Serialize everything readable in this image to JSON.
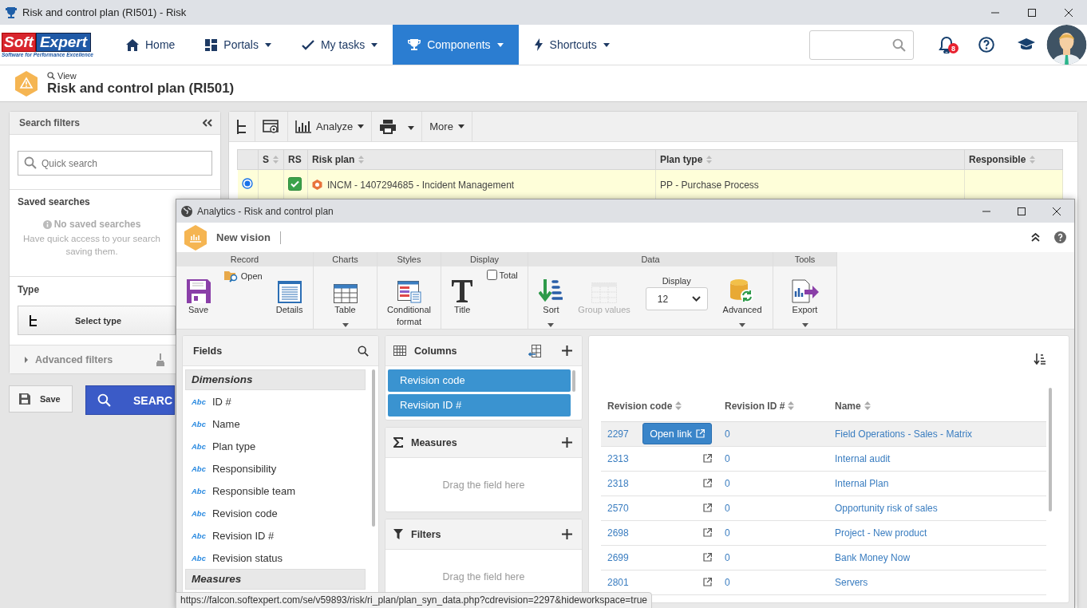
{
  "window": {
    "title": "Risk and control plan (RI501) - Risk"
  },
  "logo": {
    "word_1": "Soft",
    "word_2": "Expert",
    "tagline": "Software for Performance Excellence"
  },
  "nav": [
    {
      "label": "Home",
      "dropdown": false,
      "selected": false
    },
    {
      "label": "Portals",
      "dropdown": true,
      "selected": false
    },
    {
      "label": "My tasks",
      "dropdown": true,
      "selected": false
    },
    {
      "label": "Components",
      "dropdown": true,
      "selected": true
    },
    {
      "label": "Shortcuts",
      "dropdown": true,
      "selected": false
    }
  ],
  "notifications": {
    "count": "8"
  },
  "page": {
    "mode": "View",
    "title": "Risk and control plan (RI501)"
  },
  "filters": {
    "title": "Search filters",
    "quick_search_placeholder": "Quick search",
    "saved_title": "Saved searches",
    "empty_title": "No saved searches",
    "empty_text_1": "Have quick access to your search",
    "empty_text_2": "saving them.",
    "type_label": "Type",
    "type_button": "Select type",
    "advanced": {
      "label": "Advanced filters",
      "expanded": false
    },
    "save": "Save",
    "search": "SEARC"
  },
  "toolbar": {
    "analyze": "Analyze",
    "more": "More"
  },
  "main_table": {
    "columns": [
      "S",
      "RS",
      "Risk plan",
      "Plan type",
      "Responsible"
    ],
    "rows": [
      {
        "selected": true,
        "rs_checked": true,
        "risk_plan": "INCM - 1407294685 - Incident Management",
        "plan_type": "PP - Purchase Process"
      }
    ]
  },
  "analytics": {
    "title": "Analytics - Risk and control plan",
    "vision": "New vision",
    "ribbon": [
      {
        "title": "Record",
        "items": [
          {
            "kind": "large",
            "label": "Save",
            "dropdown": false,
            "disabled": false
          },
          {
            "kind": "small",
            "label": "Open",
            "dropdown": false,
            "disabled": false
          },
          {
            "kind": "large",
            "label": "Details",
            "dropdown": false,
            "disabled": false
          }
        ]
      },
      {
        "title": "Charts",
        "items": [
          {
            "kind": "large",
            "label": "Table",
            "dropdown": true,
            "disabled": false
          }
        ]
      },
      {
        "title": "Styles",
        "items": [
          {
            "kind": "large",
            "label": "Conditional format",
            "dropdown": false,
            "disabled": false
          }
        ]
      },
      {
        "title": "Display",
        "items": [
          {
            "kind": "large",
            "label": "Title",
            "dropdown": false,
            "disabled": false
          },
          {
            "kind": "checkbox",
            "label": "Total",
            "checked": false
          }
        ]
      },
      {
        "title": "Data",
        "items": [
          {
            "kind": "large",
            "label": "Sort",
            "dropdown": true,
            "disabled": false
          },
          {
            "kind": "large",
            "label": "Group values",
            "dropdown": false,
            "disabled": true
          },
          {
            "kind": "select",
            "label": "Display",
            "value": "12"
          },
          {
            "kind": "large",
            "label": "Advanced",
            "dropdown": true,
            "disabled": false
          }
        ]
      },
      {
        "title": "Tools",
        "items": [
          {
            "kind": "large",
            "label": "Export",
            "dropdown": true,
            "disabled": false
          }
        ]
      }
    ],
    "fields": {
      "title": "Fields",
      "sections": [
        {
          "title": "Dimensions",
          "items": [
            {
              "type": "Abc",
              "label": "ID #"
            },
            {
              "type": "Abc",
              "label": "Name"
            },
            {
              "type": "Abc",
              "label": "Plan type"
            },
            {
              "type": "Abc",
              "label": "Responsibility"
            },
            {
              "type": "Abc",
              "label": "Responsible team"
            },
            {
              "type": "Abc",
              "label": "Revision code"
            },
            {
              "type": "Abc",
              "label": "Revision ID #"
            },
            {
              "type": "Abc",
              "label": "Revision status"
            }
          ]
        },
        {
          "title": "Measures"
        }
      ]
    },
    "columns": {
      "title": "Columns",
      "items": [
        "Revision code",
        "Revision ID #"
      ]
    },
    "measures": {
      "title": "Measures",
      "placeholder": "Drag the field here"
    },
    "filters": {
      "title": "Filters",
      "placeholder": "Drag the field here"
    },
    "results": {
      "columns": [
        "Revision code",
        "Revision ID #",
        "Name"
      ],
      "open_link": "Open link",
      "rows": [
        {
          "code": "2297",
          "id": "0",
          "name": "Field Operations - Sales - Matrix",
          "hovered": true
        },
        {
          "code": "2313",
          "id": "0",
          "name": "Internal audit",
          "hovered": false
        },
        {
          "code": "2318",
          "id": "0",
          "name": "Internal Plan",
          "hovered": false
        },
        {
          "code": "2570",
          "id": "0",
          "name": "Opportunity risk of sales",
          "hovered": false
        },
        {
          "code": "2698",
          "id": "0",
          "name": "Project - New product",
          "hovered": false
        },
        {
          "code": "2699",
          "id": "0",
          "name": "Bank Money Now",
          "hovered": false
        },
        {
          "code": "2801",
          "id": "0",
          "name": "Servers",
          "hovered": false
        }
      ]
    }
  },
  "status_url": "https://falcon.softexpert.com/se/v59893/risk/ri_plan/plan_syn_data.php?cdrevision=2297&hideworkspace=true"
}
